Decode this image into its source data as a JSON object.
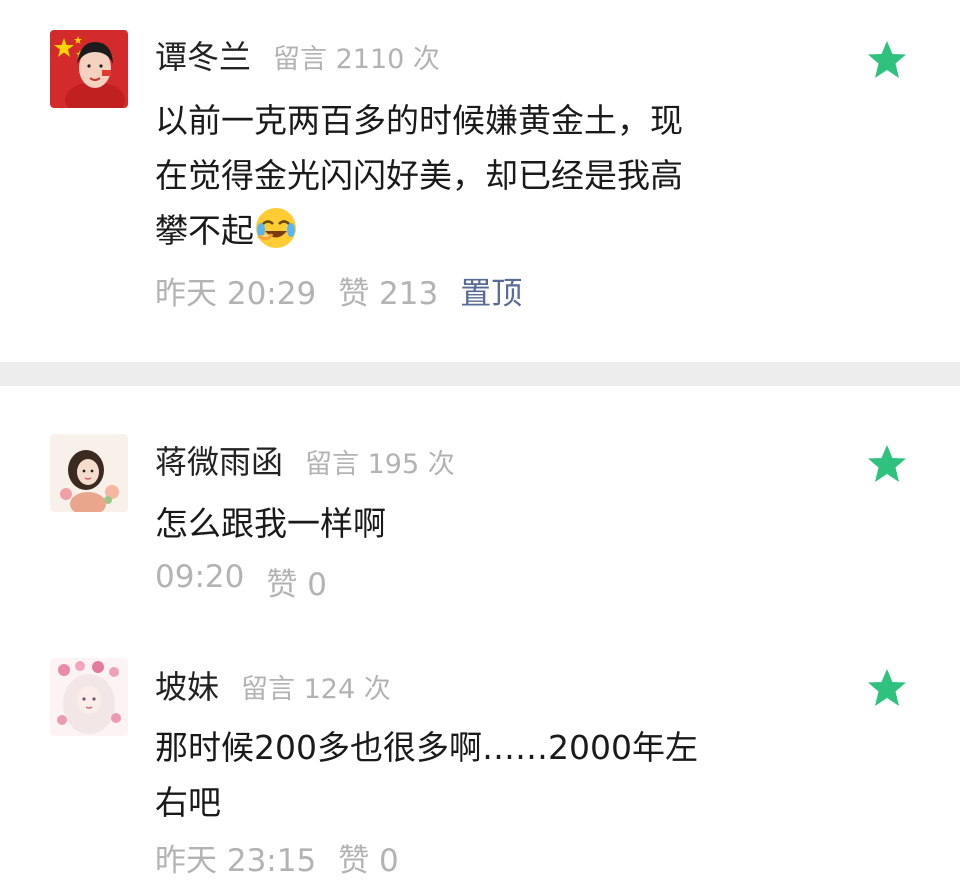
{
  "comments": [
    {
      "name": "谭冬兰",
      "count": "留言 2110 次",
      "lines": [
        "以前一克两百多的时候嫌黄金土，现",
        "在觉得金光闪闪好美，却已经是我高",
        "攀不起"
      ],
      "time": "昨天 20:29",
      "likes": "赞 213",
      "pinned": "置顶"
    },
    {
      "name": "蒋微雨函",
      "count": "留言 195 次",
      "lines": [
        "怎么跟我一样啊"
      ],
      "time": "09:20",
      "likes": "赞 0"
    },
    {
      "name": "坡妹",
      "count": "留言 124 次",
      "lines": [
        "那时候200多也很多啊……2000年左",
        "右吧"
      ],
      "time": "昨天 23:15",
      "likes": "赞 0"
    }
  ],
  "colors": {
    "star": "#2ec27e",
    "pin": "#576b95",
    "muted": "#b3b3b3",
    "divider": "#ededed"
  },
  "icons": {
    "star": "star-icon",
    "emoji": "crying-laughing-emoji-icon"
  }
}
